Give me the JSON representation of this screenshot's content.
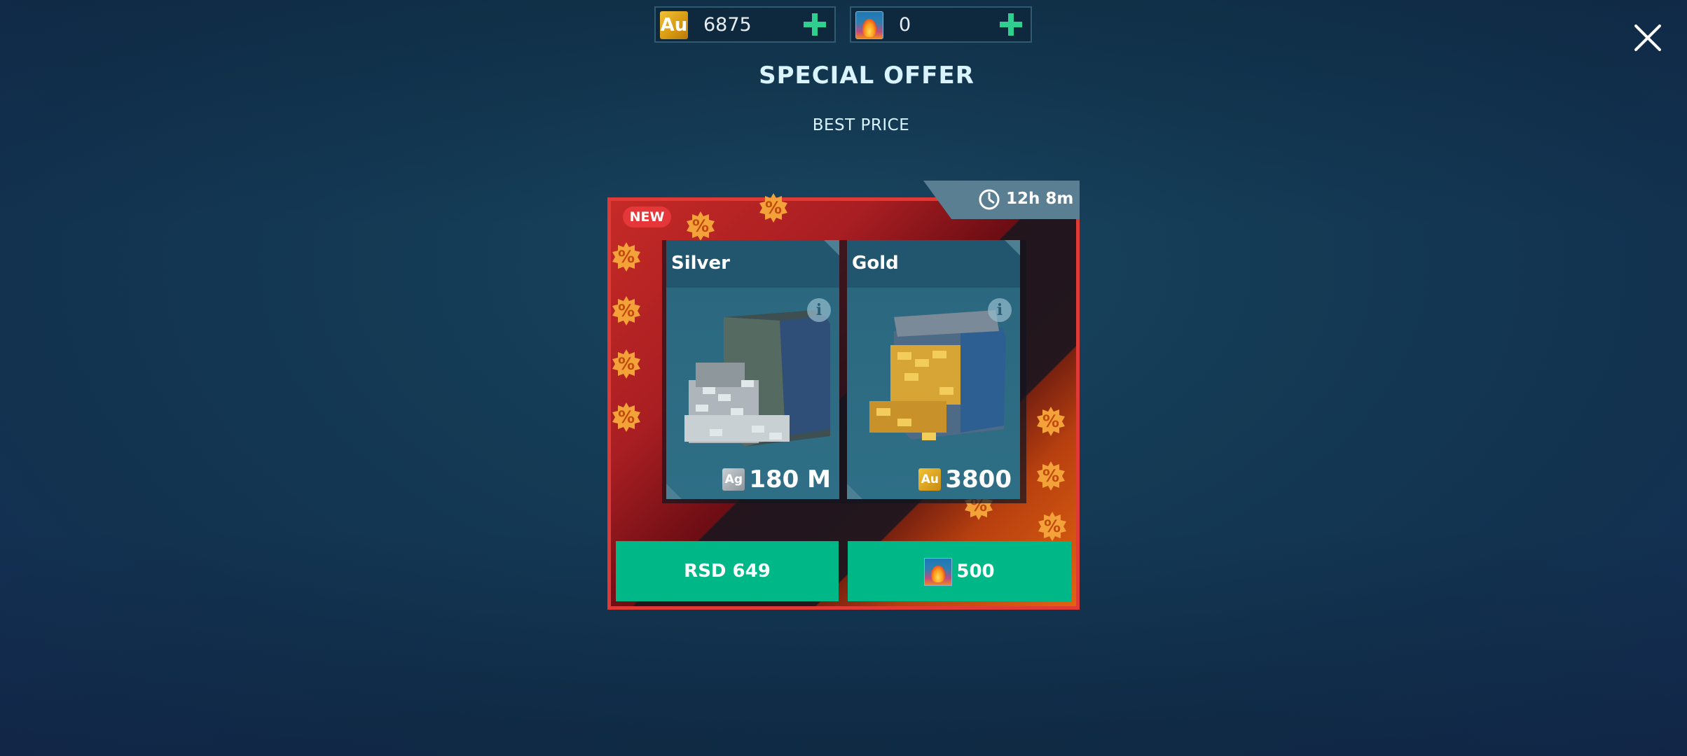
{
  "currencies": {
    "gold": {
      "icon": "au-gold-icon",
      "icon_label": "Au",
      "value": "6875"
    },
    "premium": {
      "icon": "premium-currency-icon",
      "value": "0"
    }
  },
  "header": {
    "title": "SPECIAL OFFER",
    "subtitle": "BEST PRICE"
  },
  "offer": {
    "new_label": "NEW",
    "timer": "12h 8m",
    "cards": [
      {
        "name": "Silver",
        "currency_label": "Ag",
        "amount": "180 M"
      },
      {
        "name": "Gold",
        "currency_label": "Au",
        "amount": "3800"
      }
    ],
    "buttons": {
      "real_price": "RSD 649",
      "premium_price": "500"
    }
  },
  "colors": {
    "panel_border": "#e03a36",
    "button": "#00b887",
    "plus": "#2fd08f",
    "new_badge": "#e5363a"
  }
}
